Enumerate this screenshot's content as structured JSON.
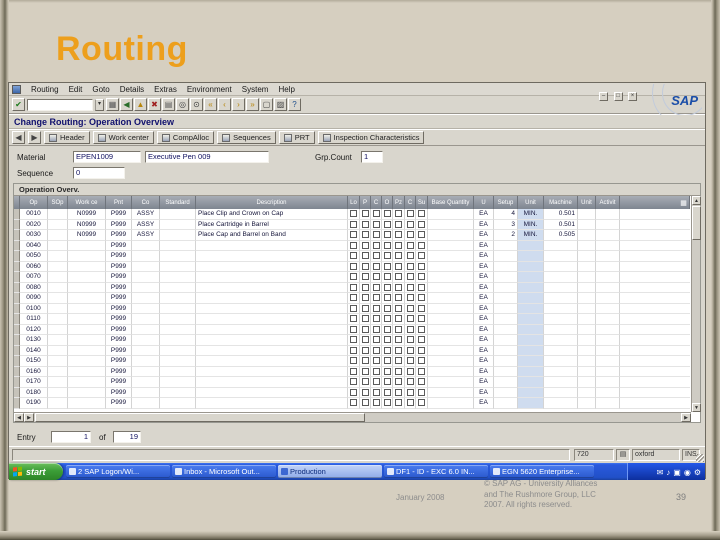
{
  "colors": {
    "title_orange": "#ED9F1C",
    "taskbar_blue": "#2A5ADE",
    "start_green": "#3C9E38",
    "highlight_column": "#CFDCEF"
  },
  "slide": {
    "title": "Routing",
    "footer": {
      "date": "January 2008",
      "copyright": [
        "© SAP AG - University Alliances",
        "and The Rushmore Group, LLC",
        "2007. All rights reserved."
      ],
      "page_number": "39"
    }
  },
  "sap": {
    "menu_items": [
      "Routing",
      "Edit",
      "Goto",
      "Details",
      "Extras",
      "Environment",
      "System",
      "Help"
    ],
    "logo_text": "SAP",
    "command_value": "",
    "window_title": "Change Routing: Operation Overview",
    "toolbar_icons": [
      {
        "name": "save-icon",
        "glyph": "▦",
        "color": "#555555"
      },
      {
        "name": "back-icon",
        "glyph": "◀",
        "color": "#2a6d2a"
      },
      {
        "name": "exit-icon",
        "glyph": "▲",
        "color": "#b8860b"
      },
      {
        "name": "cancel-icon",
        "glyph": "✖",
        "color": "#a02020"
      },
      {
        "name": "print-icon",
        "glyph": "▤",
        "color": "#555555"
      },
      {
        "name": "find-icon",
        "glyph": "◎",
        "color": "#444444"
      },
      {
        "name": "find-next-icon",
        "glyph": "⊙",
        "color": "#444444"
      },
      {
        "name": "first-page-icon",
        "glyph": "«",
        "color": "#b8860b"
      },
      {
        "name": "prev-page-icon",
        "glyph": "‹",
        "color": "#b8860b"
      },
      {
        "name": "next-page-icon",
        "glyph": "›",
        "color": "#b8860b"
      },
      {
        "name": "last-page-icon",
        "glyph": "»",
        "color": "#b8860b"
      },
      {
        "name": "new-session-icon",
        "glyph": "▢",
        "color": "#444444"
      },
      {
        "name": "create-shortcut-icon",
        "glyph": "▨",
        "color": "#444444"
      },
      {
        "name": "help-icon",
        "glyph": "?",
        "color": "#20508c"
      }
    ],
    "app_buttons": [
      "Header",
      "Work center",
      "CompAlloc",
      "Sequences",
      "PRT",
      "Inspection Characteristics"
    ],
    "form": {
      "material_label": "Material",
      "material_value": "EPEN1009",
      "material_desc": "Executive Pen 009",
      "grp_count_label": "Grp.Count",
      "grp_count_value": "1",
      "sequence_label": "Sequence",
      "sequence_value": "0"
    },
    "table": {
      "box_title": "Operation Overv.",
      "headers": [
        "Op",
        "SOp",
        "Work ce",
        "Pnt",
        "Co",
        "Standard",
        "Description",
        "Lo",
        "P",
        "C",
        "O",
        "Pz",
        "C",
        "Su",
        "Base Quantity",
        "U",
        "Setup",
        "Unit",
        "Machine",
        "Unit",
        "Activit"
      ],
      "rows": [
        {
          "op": "0010",
          "workce": "N0999",
          "pnt": "P999",
          "co": "ASSY",
          "desc": "Place Clip and Crown on Cap",
          "u": "EA",
          "setup": "4",
          "unit1": "MIN.",
          "machine": "0.501"
        },
        {
          "op": "0020",
          "workce": "N0999",
          "pnt": "P999",
          "co": "ASSY",
          "desc": "Place Cartridge in Barrel",
          "u": "EA",
          "setup": "3",
          "unit1": "MIN.",
          "machine": "0.501"
        },
        {
          "op": "0030",
          "workce": "N0999",
          "pnt": "P999",
          "co": "ASSY",
          "desc": "Place Cap and Barrel on Band",
          "u": "EA",
          "setup": "2",
          "unit1": "MIN.",
          "machine": "0.505"
        },
        {
          "op": "0040",
          "pnt": "P999",
          "u": "EA"
        },
        {
          "op": "0050",
          "pnt": "P999",
          "u": "EA"
        },
        {
          "op": "0060",
          "pnt": "P999",
          "u": "EA"
        },
        {
          "op": "0070",
          "pnt": "P999",
          "u": "EA"
        },
        {
          "op": "0080",
          "pnt": "P999",
          "u": "EA"
        },
        {
          "op": "0090",
          "pnt": "P999",
          "u": "EA"
        },
        {
          "op": "0100",
          "pnt": "P999",
          "u": "EA"
        },
        {
          "op": "0110",
          "pnt": "P999",
          "u": "EA"
        },
        {
          "op": "0120",
          "pnt": "P999",
          "u": "EA"
        },
        {
          "op": "0130",
          "pnt": "P999",
          "u": "EA"
        },
        {
          "op": "0140",
          "pnt": "P999",
          "u": "EA"
        },
        {
          "op": "0150",
          "pnt": "P999",
          "u": "EA"
        },
        {
          "op": "0160",
          "pnt": "P999",
          "u": "EA"
        },
        {
          "op": "0170",
          "pnt": "P999",
          "u": "EA"
        },
        {
          "op": "0180",
          "pnt": "P999",
          "u": "EA"
        },
        {
          "op": "0190",
          "pnt": "P999",
          "u": "EA"
        }
      ]
    },
    "entry": {
      "label": "Entry",
      "value": "1",
      "of": "of",
      "total": "19"
    },
    "status": {
      "system": "720",
      "server": "oxford",
      "mode": "INS"
    }
  },
  "taskbar": {
    "start_label": "start",
    "items": [
      {
        "label": "2 SAP Logon/Wi...",
        "style": "dark"
      },
      {
        "label": "Inbox - Microsoft Out...",
        "style": "dark"
      },
      {
        "label": "Production",
        "style": "light"
      },
      {
        "label": "DF1 - ID - EXC 6.0 IN...",
        "style": "dark"
      },
      {
        "label": "EGN 5620 Enterprise...",
        "style": "dark"
      }
    ],
    "tray_icons": [
      {
        "name": "mail-tray-icon",
        "glyph": "✉"
      },
      {
        "name": "volume-tray-icon",
        "glyph": "♪"
      },
      {
        "name": "network-tray-icon",
        "glyph": "▣"
      },
      {
        "name": "security-tray-icon",
        "glyph": "◉"
      },
      {
        "name": "settings-tray-icon",
        "glyph": "⚙"
      }
    ]
  }
}
